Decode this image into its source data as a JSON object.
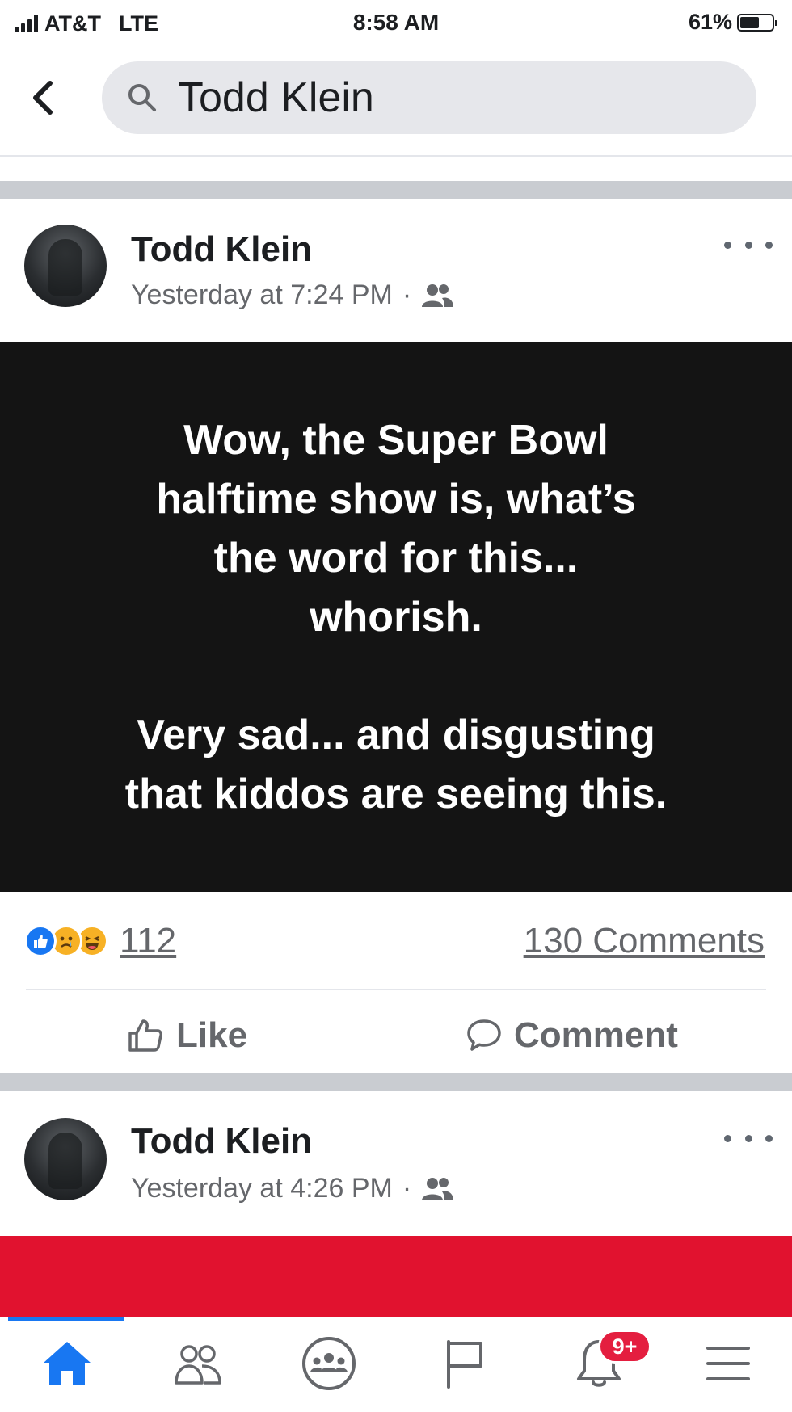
{
  "status_bar": {
    "carrier": "AT&T",
    "network": "LTE",
    "time": "8:58 AM",
    "battery": "61%",
    "battery_level": 0.61
  },
  "header": {
    "search_query": "Todd Klein",
    "back_icon": "chevron-left-icon",
    "search_icon": "magnifier-icon"
  },
  "posts": [
    {
      "author": "Todd Klein",
      "timestamp": "Yesterday at 7:24 PM",
      "separator": "·",
      "audience_icon": "friends-icon",
      "text": "Wow, the Super Bowl\nhalftime show is, what’s\nthe word for this...\nwhorish.\n\nVery sad... and disgusting\nthat kiddos are seeing this.",
      "reaction_count": "112",
      "reaction_icons": [
        "like-reaction-icon",
        "sad-reaction-icon",
        "haha-reaction-icon"
      ],
      "comments_count": "130 Comments",
      "actions": {
        "like": "Like",
        "comment": "Comment"
      }
    },
    {
      "author": "Todd Klein",
      "timestamp": "Yesterday at 4:26 PM",
      "separator": "·",
      "audience_icon": "friends-icon"
    }
  ],
  "bottom_nav": {
    "items": [
      "home-icon",
      "friends-icon",
      "groups-icon",
      "pages-flag-icon",
      "notifications-bell-icon",
      "menu-icon"
    ],
    "notification_badge": "9+"
  },
  "colors": {
    "accent": "#1877f2",
    "badge": "#e41e3f",
    "post_background": "#141414",
    "red_band": "#e1122f"
  }
}
